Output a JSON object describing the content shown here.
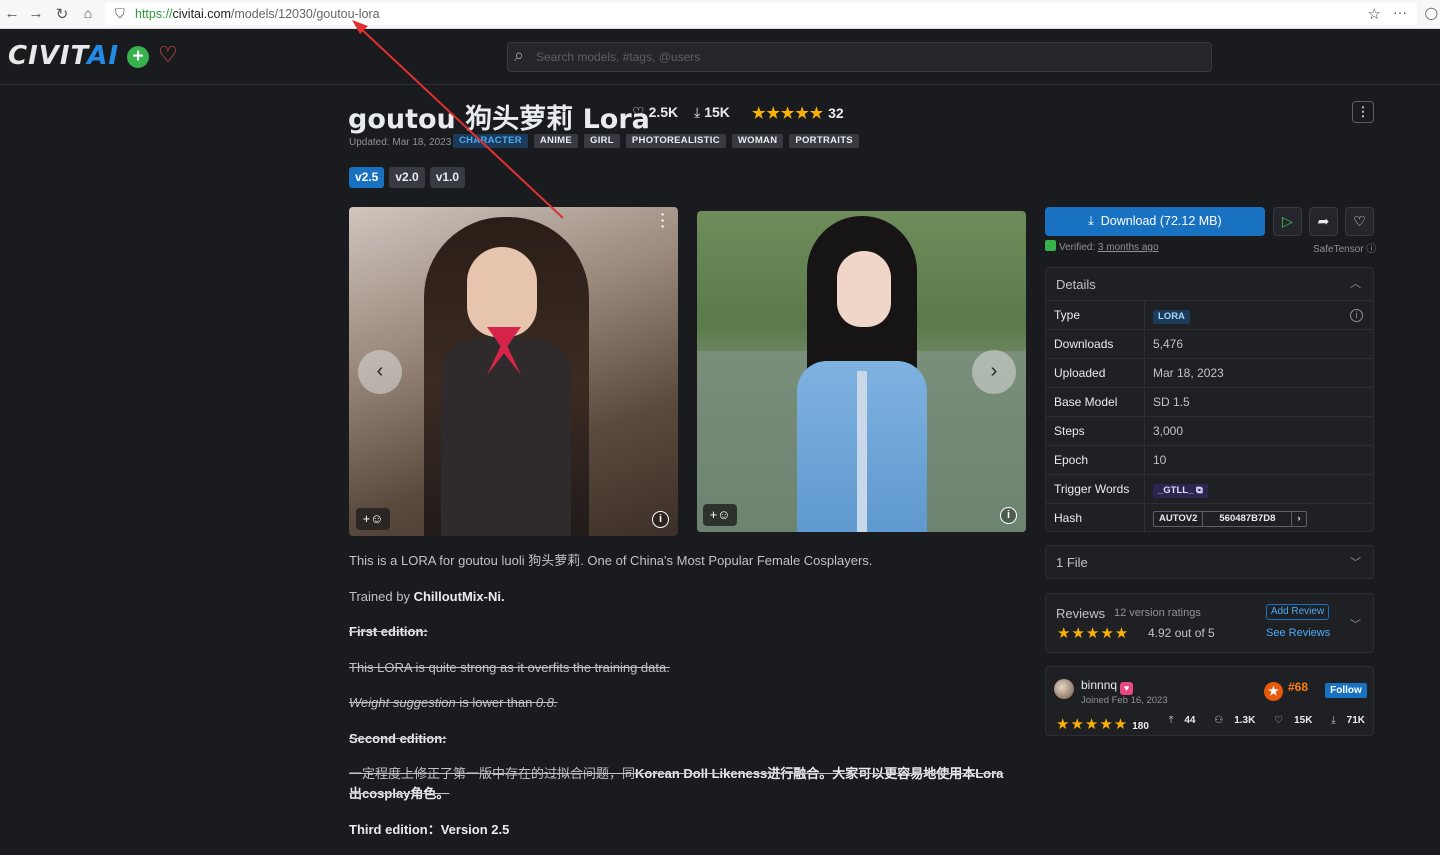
{
  "browser": {
    "url_scheme": "https://",
    "url_host": "civitai.com",
    "url_path": "/models/12030/goutou-lora",
    "back_icon": "back-arrow-icon",
    "forward_icon": "forward-arrow-icon",
    "reload_icon": "reload-icon",
    "home_icon": "home-icon"
  },
  "header": {
    "logo_main": "CIVIT",
    "logo_accent": "AI",
    "plus": "+",
    "search_placeholder": "Search models, #tags, @users",
    "brand_color": "#228be6"
  },
  "model": {
    "title": "goutou 狗头萝莉 Lora",
    "likes": "2.5K",
    "downloads": "15K",
    "rating_count": "32",
    "stars": "★★★★★",
    "updated": "Updated: Mar 18, 2023",
    "tags": [
      "CHARACTER",
      "ANIME",
      "GIRL",
      "PHOTOREALISTIC",
      "WOMAN",
      "PORTRAITS"
    ],
    "versions": [
      "v2.5",
      "v2.0",
      "v1.0"
    ]
  },
  "description": {
    "p1": "This is a LORA for goutou luoli 狗头萝莉. One of China's Most Popular Female Cosplayers.",
    "p2_prefix": "Trained by ",
    "p2_bold": "ChilloutMix-Ni.",
    "p3": "First edition:",
    "p4": "This LORA is quite strong as it overfits the training data.",
    "p5_em": "Weight suggestion",
    "p5_mid": " is lower than ",
    "p5_em2": "0.8.",
    "p6": "Second edition:",
    "p7_a": "一定程度上修正了第一版中存在的过拟合问题，同",
    "p7_b": "Korean Doll Likeness",
    "p7_c": "进行融合。大家可以更容易地使用本Lora出cosplay角色。",
    "p8": "Third edition：Version 2.5"
  },
  "sidebar": {
    "download_label": "Download (72.12 MB)",
    "verified_prefix": "Verified: ",
    "verified_when": "3 months ago",
    "safetensor": "SafeTensor",
    "details_title": "Details",
    "details": [
      {
        "k": "Type",
        "v": "LORA"
      },
      {
        "k": "Downloads",
        "v": "5,476"
      },
      {
        "k": "Uploaded",
        "v": "Mar 18, 2023"
      },
      {
        "k": "Base Model",
        "v": "SD 1.5"
      },
      {
        "k": "Steps",
        "v": "3,000"
      },
      {
        "k": "Epoch",
        "v": "10"
      },
      {
        "k": "Trigger Words",
        "v": "_GTLL_"
      },
      {
        "k": "Hash",
        "v_type": "AUTOV2",
        "v": "560487B7D8"
      }
    ],
    "files_label": "1 File",
    "reviews_title": "Reviews",
    "reviews_count": "12 version ratings",
    "reviews_stars": "★★★★★",
    "reviews_score": "4.92 out of 5",
    "add_review": "Add Review",
    "see_reviews": "See Reviews"
  },
  "creator": {
    "name": "binnnq",
    "joined": "Joined Feb 16, 2023",
    "rank": "#68",
    "follow": "Follow",
    "stars": "★★★★★",
    "rating_count": "180",
    "uploads": "44",
    "followers": "1.3K",
    "likes": "15K",
    "downloads": "71K"
  }
}
